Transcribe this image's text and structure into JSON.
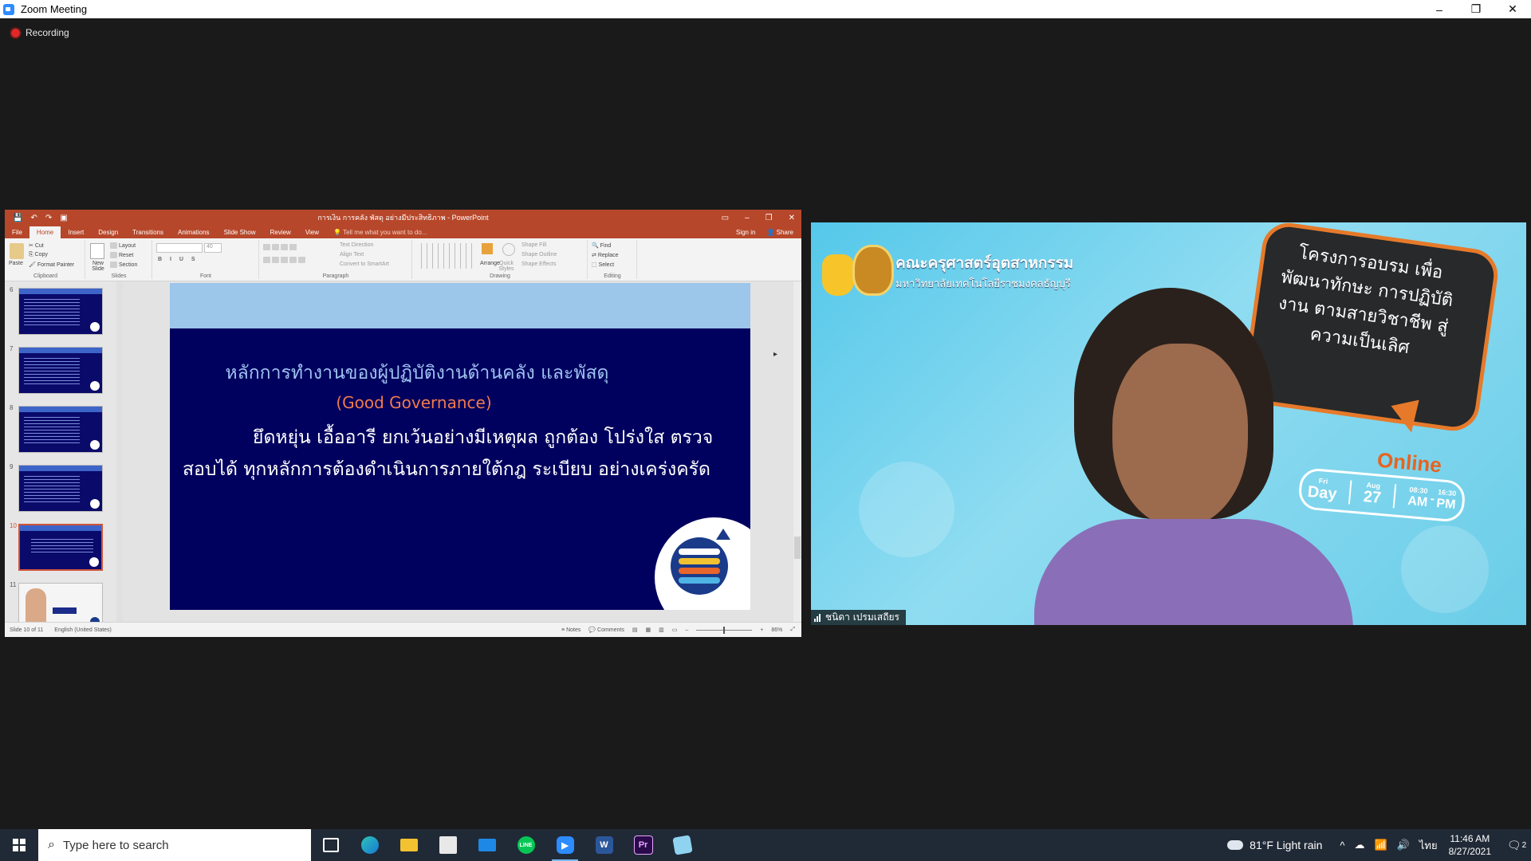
{
  "zoom": {
    "title": "Zoom Meeting",
    "recording_label": "Recording",
    "window_controls": [
      "–",
      "❐",
      "✕"
    ]
  },
  "ppt": {
    "doc_title": "การเงิน การคลัง พัสดุ อย่างมีประสิทธิภาพ - PowerPoint",
    "tabs": [
      "File",
      "Home",
      "Insert",
      "Design",
      "Transitions",
      "Animations",
      "Slide Show",
      "Review",
      "View"
    ],
    "active_tab": "Home",
    "tell_me": "Tell me what you want to do...",
    "sign_in": "Sign in",
    "share": "Share",
    "ribbon": {
      "clipboard": {
        "paste": "Paste",
        "cut": "Cut",
        "copy": "Copy",
        "format_painter": "Format Painter",
        "label": "Clipboard"
      },
      "slides": {
        "new_slide": "New Slide",
        "layout": "Layout",
        "reset": "Reset",
        "section": "Section",
        "label": "Slides"
      },
      "font": {
        "size": "40",
        "label": "Font"
      },
      "paragraph": {
        "text_direction": "Text Direction",
        "align_text": "Align Text",
        "convert_smartart": "Convert to SmartArt",
        "label": "Paragraph"
      },
      "drawing": {
        "arrange": "Arrange",
        "quick_styles": "Quick Styles",
        "shape_fill": "Shape Fill",
        "shape_outline": "Shape Outline",
        "shape_effects": "Shape Effects",
        "label": "Drawing"
      },
      "editing": {
        "find": "Find",
        "replace": "Replace",
        "select": "Select",
        "label": "Editing"
      }
    },
    "thumbnails": [
      {
        "num": "6"
      },
      {
        "num": "7"
      },
      {
        "num": "8"
      },
      {
        "num": "9"
      },
      {
        "num": "10",
        "selected": true
      },
      {
        "num": "11"
      }
    ],
    "slide": {
      "heading": "หลักการทำงานของผู้ปฏิบัติงานด้านคลัง และพัสดุ",
      "subheading": "(Good Governance)",
      "body": "ยึดหยุ่น เอื้ออารี ยกเว้นอย่างมีเหตุผล ถูกต้อง โปร่งใส ตรวจสอบได้ ทุกหลักการต้องดำเนินการภายใต้กฎ ระเบียบ อย่างเคร่งครัด"
    },
    "status": {
      "slide_of": "Slide 10 of 11",
      "language": "English (United States)",
      "notes": "Notes",
      "comments": "Comments",
      "zoom": "86%"
    }
  },
  "video": {
    "header_line1": "คณะครุศาสตร์อุตสาหกรรม",
    "header_line2": "มหาวิทยาลัยเทคโนโลยีราชมงคลธัญบุรี",
    "bubble_text": "โครงการอบรม เพื่อพัฒนาทักษะ การปฏิบัติงาน ตามสายวิชาชีพ สู่ความเป็นเลิศ",
    "online": "Online",
    "date": {
      "fri": "Fri",
      "day": "Day",
      "aug": "Aug",
      "num": "27",
      "start": "08:30",
      "am": "AM",
      "dash": "-",
      "end": "16:30",
      "pm": "PM"
    },
    "participant_name": "ชนิดา เปรมเสถียร"
  },
  "taskbar": {
    "search_placeholder": "Type here to search",
    "weather": "81°F  Light rain",
    "lang": "ไทย",
    "time": "11:46 AM",
    "date": "8/27/2021",
    "notifications": "2"
  },
  "colors": {
    "ppt_accent": "#b7472a",
    "slide_bg": "#00005e",
    "slide_heading": "#9fc3f0",
    "slide_sub": "#f07a4e",
    "taskbar": "#202a36"
  }
}
